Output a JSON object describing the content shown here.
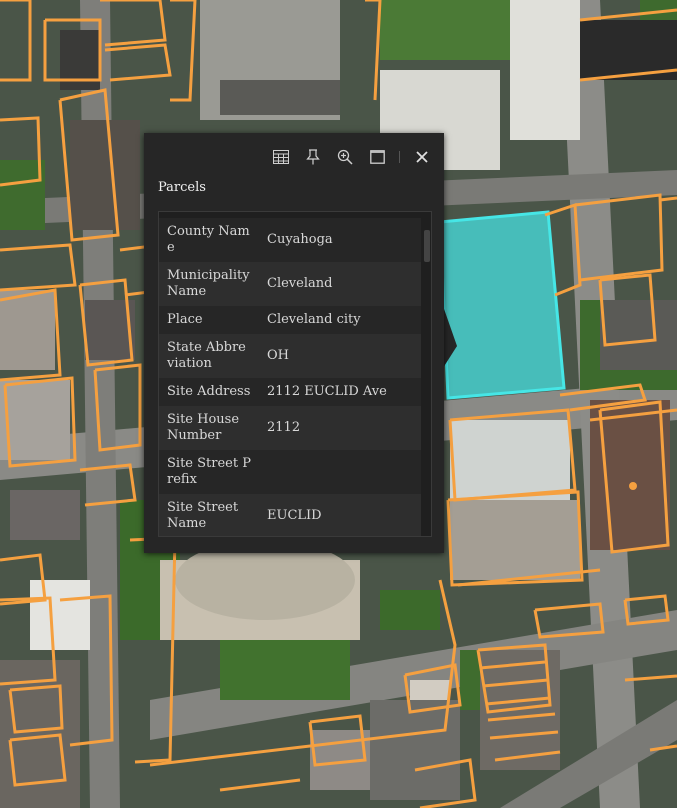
{
  "popup": {
    "title": "Parcels",
    "rows": [
      {
        "k": "County Name",
        "v": "Cuyahoga"
      },
      {
        "k": "Municipality Name",
        "v": "Cleveland"
      },
      {
        "k": "Place",
        "v": "Cleveland city"
      },
      {
        "k": "State Abbreviation",
        "v": "OH"
      },
      {
        "k": "Site Address",
        "v": "2112 EUCLID Ave"
      },
      {
        "k": "Site House Number",
        "v": "2112"
      },
      {
        "k": "Site Street Prefix",
        "v": ""
      },
      {
        "k": "Site Street Name",
        "v": "EUCLID"
      }
    ],
    "toolbar": {
      "table_icon": "table-icon",
      "pin_icon": "pin-icon",
      "zoom_icon": "zoom-to-icon",
      "maximize_icon": "maximize-icon",
      "close_icon": "close-icon"
    }
  },
  "colors": {
    "parcel_outline": "#f5a040",
    "selected_fill": "#46e6e6",
    "popup_bg": "#262626"
  }
}
